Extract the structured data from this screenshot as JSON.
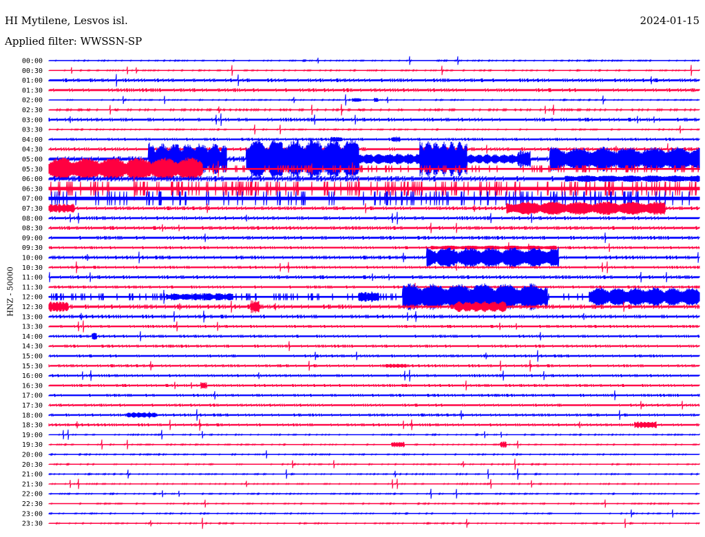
{
  "header": {
    "station": "HI Mytilene, Lesvos isl.",
    "filter": "Applied filter: WWSSN-SP",
    "date": "2024-01-15"
  },
  "chart_data": {
    "type": "line",
    "title": "HI Mytilene, Lesvos isl.",
    "ylabel": "HNZ - 50000",
    "x_unit": "minutes within row",
    "xlim": [
      0,
      30
    ],
    "colors": {
      "hour": "#0000ff",
      "half_hour": "#ff0040"
    },
    "rows": [
      "00:00",
      "00:30",
      "01:00",
      "01:30",
      "02:00",
      "02:30",
      "03:00",
      "03:30",
      "04:00",
      "04:30",
      "05:00",
      "05:30",
      "06:00",
      "06:30",
      "07:00",
      "07:30",
      "08:00",
      "08:30",
      "09:00",
      "09:30",
      "10:00",
      "10:30",
      "11:00",
      "11:30",
      "12:00",
      "12:30",
      "13:00",
      "13:30",
      "14:00",
      "14:30",
      "15:00",
      "15:30",
      "16:00",
      "16:30",
      "17:00",
      "17:30",
      "18:00",
      "18:30",
      "19:00",
      "19:30",
      "20:00",
      "20:30",
      "21:00",
      "21:30",
      "22:00",
      "22:30",
      "23:00",
      "23:30"
    ],
    "noise": [
      0.3,
      0.3,
      1,
      1,
      0.3,
      0.5,
      1,
      0.3,
      0.8,
      1,
      1.5,
      2,
      1.5,
      4,
      4,
      1,
      1,
      1,
      1,
      0.8,
      1,
      0.8,
      1,
      0.8,
      2,
      1.2,
      1,
      0.8,
      0.8,
      0.8,
      0.8,
      0.8,
      0.8,
      0.8,
      0.8,
      0.8,
      0.8,
      0.8,
      0.3,
      0.3,
      0.3,
      0.3,
      0.3,
      0.3,
      0.3,
      0.3,
      0.3,
      0.3
    ],
    "events": [
      {
        "row": 4,
        "start": 14.0,
        "end": 14.4,
        "amp": 3
      },
      {
        "row": 4,
        "start": 15.0,
        "end": 15.2,
        "amp": 4
      },
      {
        "row": 8,
        "start": 13.0,
        "end": 13.5,
        "amp": 4
      },
      {
        "row": 8,
        "start": 15.8,
        "end": 16.2,
        "amp": 4
      },
      {
        "row": 10,
        "start": 4.6,
        "end": 8.2,
        "amp": 24
      },
      {
        "row": 10,
        "start": 9.1,
        "end": 14.3,
        "amp": 30
      },
      {
        "row": 10,
        "start": 14.3,
        "end": 17.1,
        "amp": 8
      },
      {
        "row": 10,
        "start": 17.1,
        "end": 19.3,
        "amp": 28
      },
      {
        "row": 10,
        "start": 19.3,
        "end": 21.6,
        "amp": 7
      },
      {
        "row": 10,
        "start": 21.6,
        "end": 22.2,
        "amp": 14
      },
      {
        "row": 10,
        "start": 23.1,
        "end": 30,
        "amp": 18
      },
      {
        "row": 11,
        "start": 0,
        "end": 7.1,
        "amp": 17
      },
      {
        "row": 12,
        "start": 23.8,
        "end": 30,
        "amp": 5
      },
      {
        "row": 15,
        "start": 0,
        "end": 1.2,
        "amp": 7
      },
      {
        "row": 15,
        "start": 21.1,
        "end": 28.4,
        "amp": 10
      },
      {
        "row": 19,
        "start": 17.6,
        "end": 23.4,
        "amp": 3
      },
      {
        "row": 20,
        "start": 17.4,
        "end": 23.5,
        "amp": 15
      },
      {
        "row": 24,
        "start": 5.4,
        "end": 8.5,
        "amp": 5
      },
      {
        "row": 24,
        "start": 14.3,
        "end": 15.2,
        "amp": 8
      },
      {
        "row": 24,
        "start": 16.3,
        "end": 23.0,
        "amp": 20
      },
      {
        "row": 24,
        "start": 24.9,
        "end": 30,
        "amp": 14
      },
      {
        "row": 25,
        "start": 0,
        "end": 0.9,
        "amp": 8
      },
      {
        "row": 25,
        "start": 9.3,
        "end": 9.7,
        "amp": 10
      },
      {
        "row": 25,
        "start": 18.7,
        "end": 21.1,
        "amp": 8
      },
      {
        "row": 28,
        "start": 2.0,
        "end": 2.2,
        "amp": 5
      },
      {
        "row": 31,
        "start": 15.5,
        "end": 16.5,
        "amp": 3
      },
      {
        "row": 33,
        "start": 7.0,
        "end": 7.3,
        "amp": 5
      },
      {
        "row": 36,
        "start": 3.6,
        "end": 5.0,
        "amp": 4
      },
      {
        "row": 37,
        "start": 27.0,
        "end": 28.0,
        "amp": 5
      },
      {
        "row": 39,
        "start": 15.8,
        "end": 16.4,
        "amp": 4
      },
      {
        "row": 39,
        "start": 20.8,
        "end": 21.1,
        "amp": 5
      }
    ]
  }
}
